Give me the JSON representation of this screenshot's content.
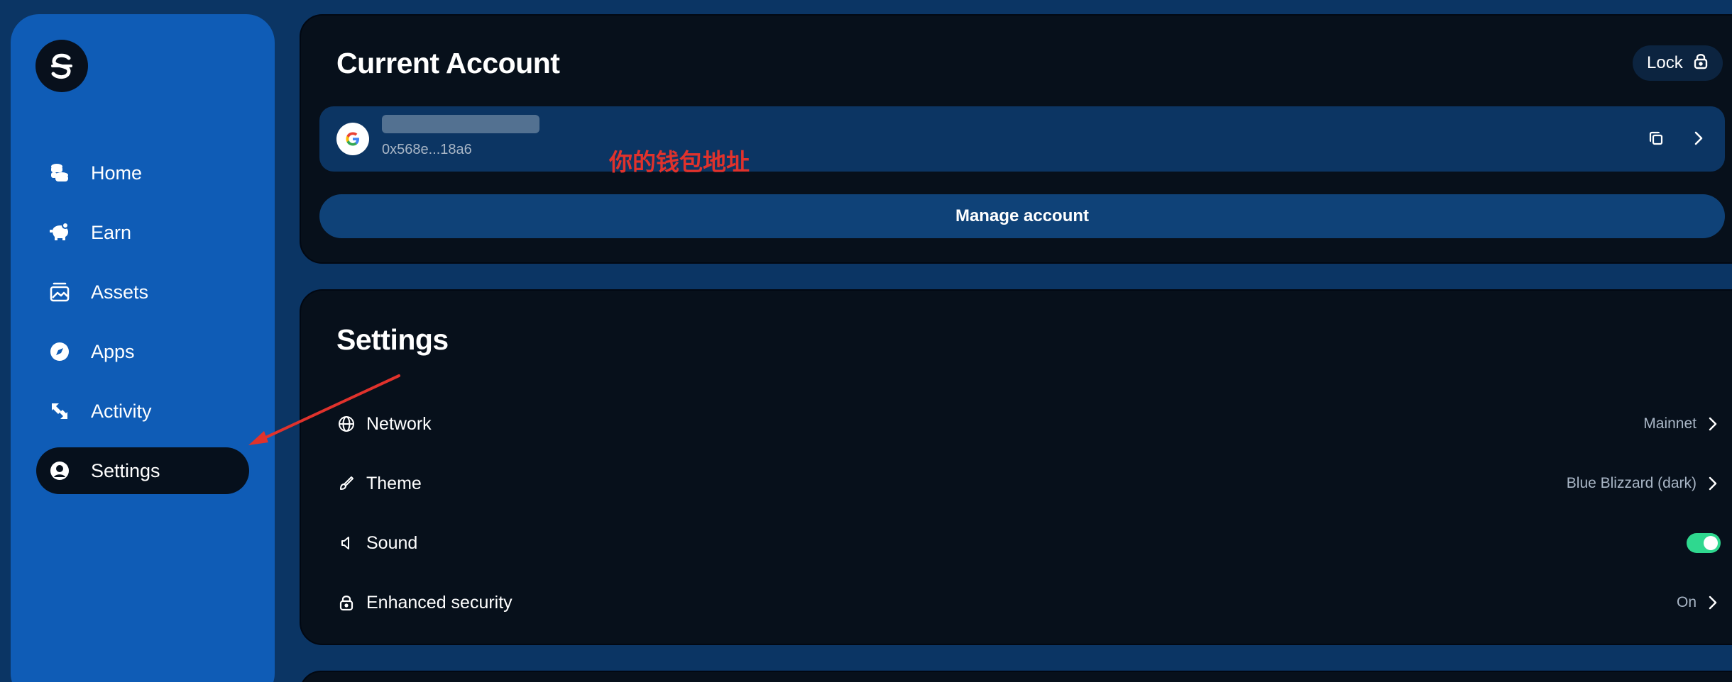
{
  "sidebar": {
    "logo": "sui-logo-icon",
    "items": [
      {
        "label": "Home",
        "icon": "coins-icon",
        "active": false
      },
      {
        "label": "Earn",
        "icon": "piggy-bank-icon",
        "active": false
      },
      {
        "label": "Assets",
        "icon": "image-gallery-icon",
        "active": false
      },
      {
        "label": "Apps",
        "icon": "compass-icon",
        "active": false
      },
      {
        "label": "Activity",
        "icon": "swap-arrows-icon",
        "active": false
      },
      {
        "label": "Settings",
        "icon": "user-circle-icon",
        "active": true
      }
    ]
  },
  "account": {
    "title": "Current Account",
    "lock_label": "Lock",
    "provider_icon": "google-icon",
    "address": "0x568e...18a6",
    "annotation": "你的钱包地址",
    "manage_label": "Manage account"
  },
  "settings": {
    "title": "Settings",
    "rows": [
      {
        "label": "Network",
        "icon": "globe-icon",
        "value": "Mainnet",
        "control": "chevron"
      },
      {
        "label": "Theme",
        "icon": "brush-icon",
        "value": "Blue Blizzard (dark)",
        "control": "chevron"
      },
      {
        "label": "Sound",
        "icon": "speaker-icon",
        "value": "",
        "control": "toggle",
        "toggle_on": true
      },
      {
        "label": "Enhanced security",
        "icon": "lock-icon",
        "value": "On",
        "control": "chevron"
      }
    ]
  },
  "colors": {
    "background": "#0b3564",
    "sidebar": "#0f5cb6",
    "card": "#07101b",
    "toggle_on": "#2fd88f",
    "annotation": "#e0322c"
  }
}
